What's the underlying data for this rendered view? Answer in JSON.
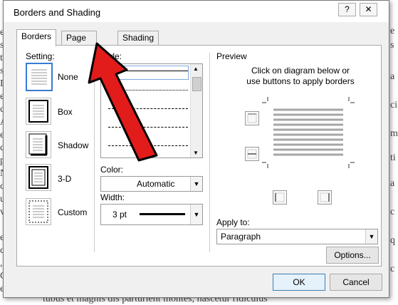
{
  "title": "Borders and Shading",
  "titlebar": {
    "help_glyph": "?",
    "close_glyph": "✕"
  },
  "tabs": [
    {
      "label": "Borders",
      "active": true
    },
    {
      "label": "Page Border",
      "active": false
    },
    {
      "label": "Shading",
      "active": false
    }
  ],
  "setting": {
    "label": "Setting:",
    "items": [
      {
        "label": "None",
        "selected": true
      },
      {
        "label": "Box",
        "selected": false
      },
      {
        "label": "Shadow",
        "selected": false
      },
      {
        "label": "3-D",
        "selected": false
      },
      {
        "label": "Custom",
        "selected": false
      }
    ]
  },
  "style": {
    "label": "Style:"
  },
  "color": {
    "label": "Color:",
    "value": "Automatic"
  },
  "width": {
    "label": "Width:",
    "value": "3 pt"
  },
  "preview": {
    "label": "Preview",
    "instructions": "Click on diagram below or\nuse buttons to apply borders"
  },
  "apply_to": {
    "label": "Apply to:",
    "value": "Paragraph"
  },
  "buttons": {
    "options": "Options...",
    "ok": "OK",
    "cancel": "Cancel"
  },
  "colors": {
    "arrow": "#e21b1b",
    "dialog_bg": "#f0f0f0",
    "selection": "#3a7bd5"
  }
}
